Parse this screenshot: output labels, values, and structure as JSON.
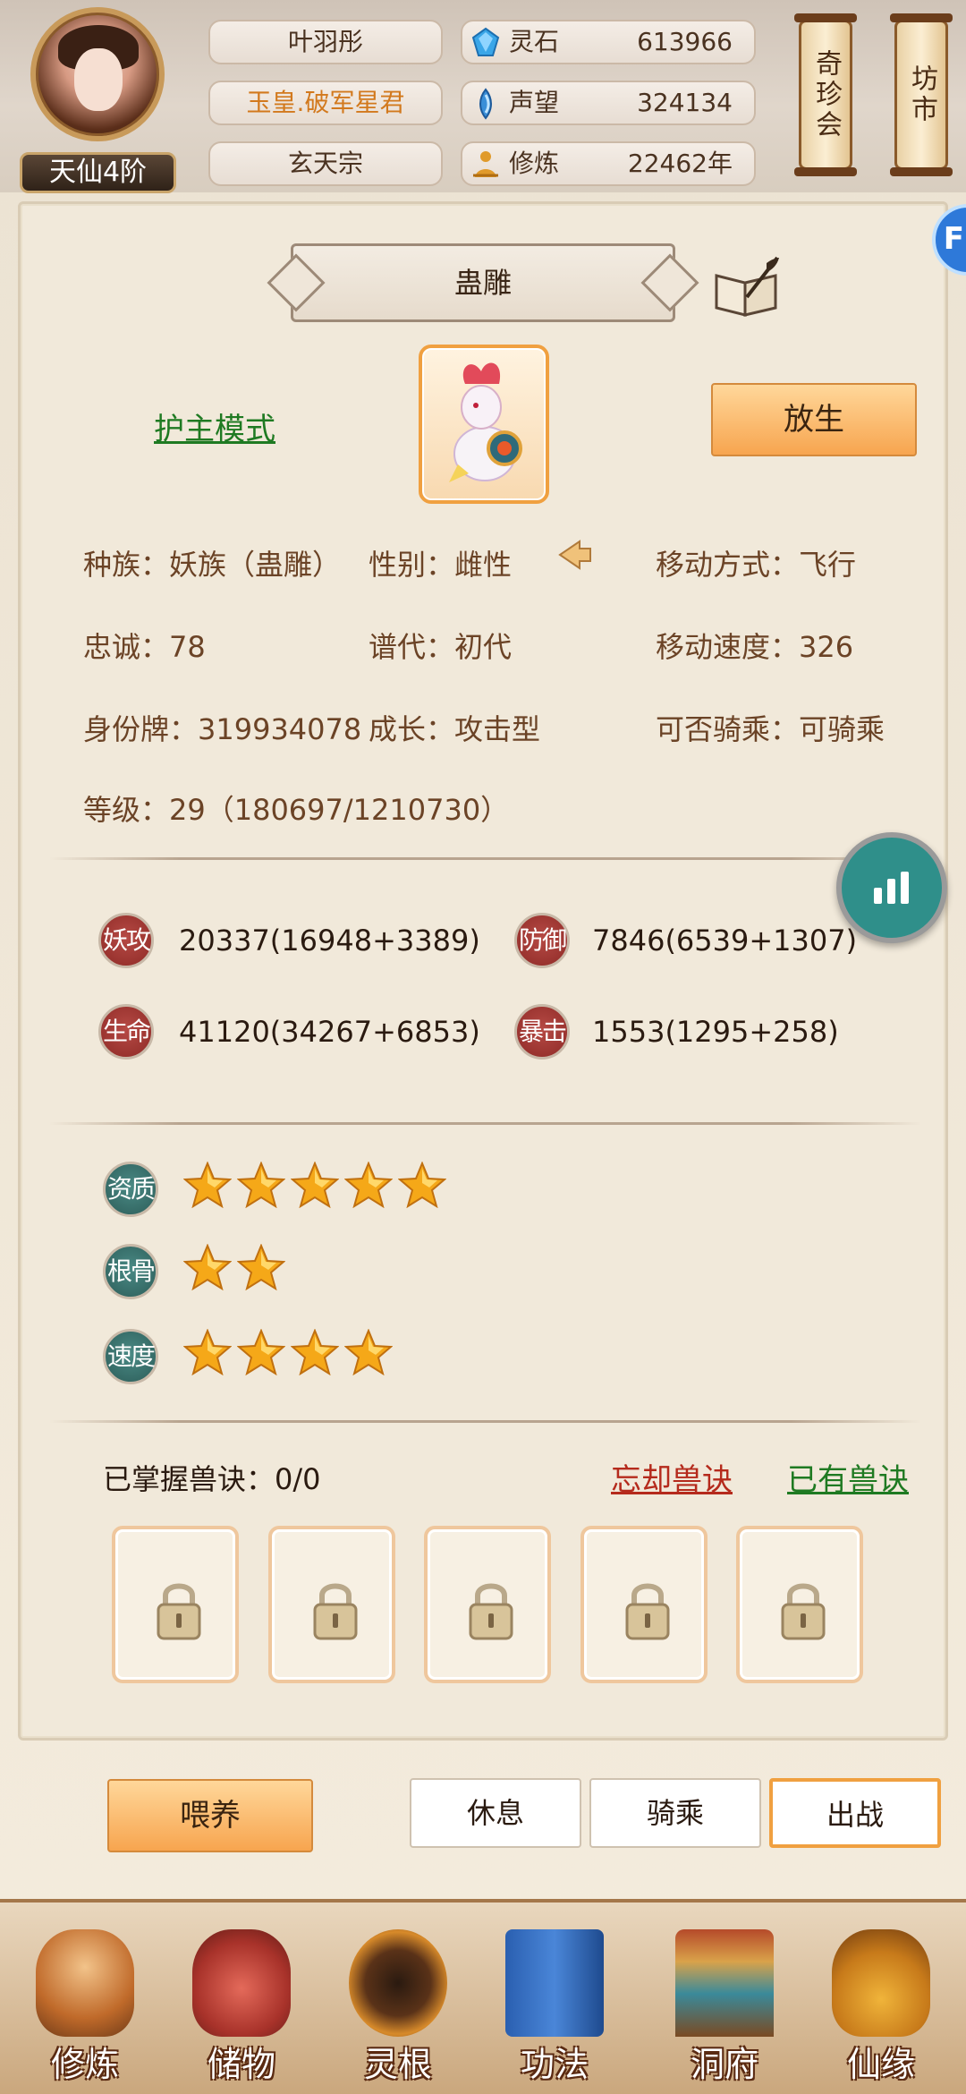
{
  "player": {
    "name": "叶羽彤",
    "title": "玉皇.破军星君",
    "sect": "玄天宗",
    "rank": "天仙4阶"
  },
  "resources": [
    {
      "label": "灵石",
      "value": "613966",
      "icon": "spirit-stone-icon"
    },
    {
      "label": "声望",
      "value": "324134",
      "icon": "prestige-icon"
    },
    {
      "label": "修炼",
      "value": "22462年",
      "icon": "meditation-icon"
    }
  ],
  "top_buttons": {
    "treasure_fair": "奇珍会",
    "market": "坊市"
  },
  "side_tab": {
    "label": "F"
  },
  "pet": {
    "name": "蛊雕",
    "mode_link": "护主模式",
    "release_button": "放生",
    "info": {
      "race": "种族：妖族（蛊雕）",
      "gender": "性别：雌性",
      "move_type": "移动方式：飞行",
      "loyalty": "忠诚：78",
      "generation": "谱代：初代",
      "move_speed": "移动速度：326",
      "id_tag": "身份牌：319934078",
      "growth": "成长：攻击型",
      "rideable": "可否骑乘：可骑乘",
      "level": "等级：29（180697/1210730）"
    },
    "attributes": [
      {
        "seal": "妖攻",
        "value": "20337(16948+3389)"
      },
      {
        "seal": "防御",
        "value": "7846(6539+1307)"
      },
      {
        "seal": "生命",
        "value": "41120(34267+6853)"
      },
      {
        "seal": "暴击",
        "value": "1553(1295+258)"
      }
    ],
    "ratings": [
      {
        "seal": "资质",
        "stars": 5
      },
      {
        "seal": "根骨",
        "stars": 2
      },
      {
        "seal": "速度",
        "stars": 4
      }
    ],
    "skills": {
      "mastered_label": "已掌握兽诀：0/0",
      "forget_link": "忘却兽诀",
      "owned_link": "已有兽诀",
      "slots": [
        "locked",
        "locked",
        "locked",
        "locked",
        "locked"
      ]
    }
  },
  "actions": {
    "feed": "喂养",
    "rest": "休息",
    "ride": "骑乘",
    "battle": "出战"
  },
  "bottom_nav": [
    {
      "label": "修炼",
      "icon": "monk-icon"
    },
    {
      "label": "储物",
      "icon": "pouch-icon"
    },
    {
      "label": "灵根",
      "icon": "spirit-root-icon"
    },
    {
      "label": "功法",
      "icon": "scripture-icon"
    },
    {
      "label": "洞府",
      "icon": "cave-mansion-icon"
    },
    {
      "label": "仙缘",
      "icon": "gourd-icon"
    }
  ],
  "colors": {
    "accent_orange": "#f7a54f",
    "link_green": "#1f7a22",
    "link_red": "#b52a1c",
    "star_gold": "#f5a818"
  }
}
